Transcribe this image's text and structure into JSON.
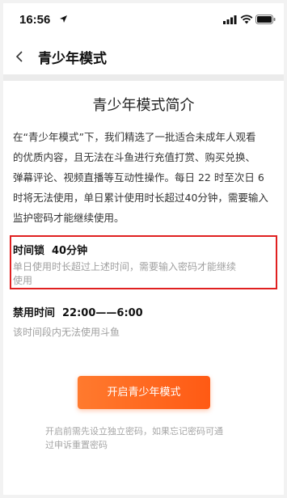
{
  "status_bar": {
    "time": "16:56"
  },
  "nav": {
    "title": "青少年模式"
  },
  "page": {
    "title": "青少年模式简介",
    "intro_lines": [
      "在“青少年模式”下，我们精选了一批适合未成年人观看",
      "的优质内容，且无法在斗鱼进行充值打赏、购买兑换、",
      "弹幕评论、视频直播等互动性操作。每日 22 时至次日 6",
      "时将无法使用，单日累计使用时长超过40分钟，需要输入",
      "监护密码才能继续使用。"
    ]
  },
  "time_lock": {
    "label": "时间锁",
    "value": "40分钟",
    "desc_lines": [
      "单日使用时长超过上述时间，需要输入密码才能继续",
      "使用"
    ]
  },
  "ban_period": {
    "label": "禁用时间",
    "value": "22:00——6:00",
    "desc": "该时间段内无法使用斗鱼"
  },
  "enable_button": {
    "label": "开启青少年模式"
  },
  "footnote_lines": [
    "开启前需先设立独立密码，如果忘记密码可通",
    "过申诉重置密码"
  ],
  "colors": {
    "accent": "#ff6a1e",
    "highlight_border": "#e02020",
    "muted_text": "#a0a0a0"
  }
}
